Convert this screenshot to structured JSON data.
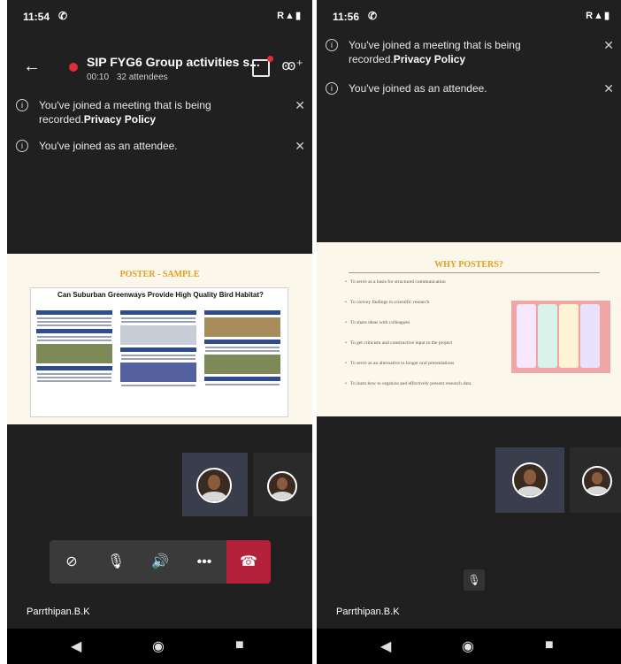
{
  "left": {
    "status": {
      "time": "11:54",
      "call_icon": "phone-icon",
      "signal": "R▲▮"
    },
    "meeting": {
      "title": "SIP FYG6 Group activities s...",
      "elapsed": "00:10",
      "attendees": "32 attendees"
    },
    "notices": [
      {
        "text": "You've joined a meeting that is being recorded.",
        "link": "Privacy Policy"
      },
      {
        "text": "You've joined as an attendee.",
        "link": ""
      }
    ],
    "slide": {
      "title": "POSTER - SAMPLE",
      "poster_title": "Can Suburban Greenways Provide High Quality Bird Habitat?"
    },
    "controls": {
      "camera": "camera-off-icon",
      "mic": "mic-off-icon",
      "speaker": "speaker-icon",
      "more": "•••",
      "end": "end-call-icon"
    },
    "presenter_name": "Parrthipan.B.K"
  },
  "right": {
    "status": {
      "time": "11:56",
      "call_icon": "phone-icon",
      "signal": "R▲▮"
    },
    "notices": [
      {
        "text": "You've joined a meeting that is being recorded.",
        "link": "Privacy Policy"
      },
      {
        "text": "You've joined as an attendee.",
        "link": ""
      }
    ],
    "slide": {
      "title": "WHY POSTERS?",
      "bullets": [
        "To serve as a basis for structured communication",
        "To convey findings in scientific research",
        "To share ideas with colleagues",
        "To get criticism and constructive input to the project",
        "To serve as an alternative to longer oral presentations",
        "To learn how to organize and effectively present research data"
      ]
    },
    "presenter_name": "Parrthipan.B.K"
  },
  "colors": {
    "background": "#202021",
    "accent_red": "#b3213a",
    "slide_title": "#e2a021"
  }
}
